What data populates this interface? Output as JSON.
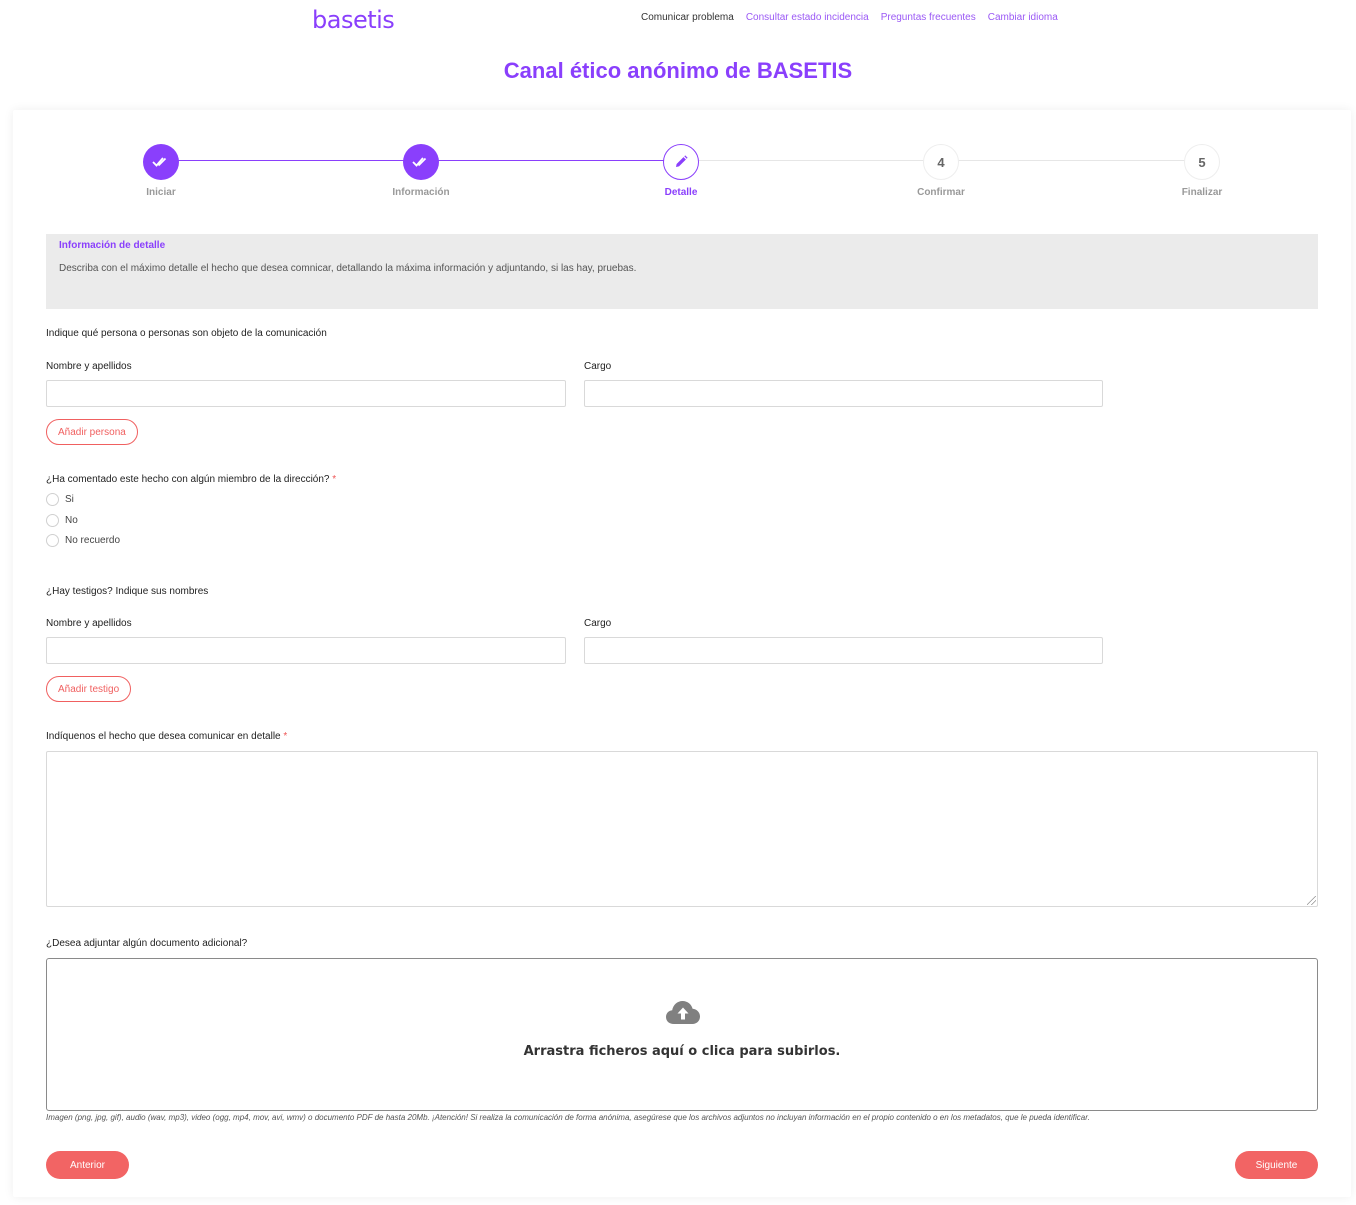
{
  "header": {
    "logo": "basetis",
    "nav": [
      "Comunicar problema",
      "Consultar estado incidencia",
      "Preguntas frecuentes",
      "Cambiar idioma"
    ]
  },
  "page_title": "Canal ético anónimo de BASETIS",
  "stepper": {
    "steps": [
      {
        "label": "Iniciar",
        "state": "done",
        "icon": "double-check-icon"
      },
      {
        "label": "Información",
        "state": "done",
        "icon": "double-check-icon"
      },
      {
        "label": "Detalle",
        "state": "active",
        "icon": "pencil-icon"
      },
      {
        "label": "Confirmar",
        "state": "todo",
        "number": "4"
      },
      {
        "label": "Finalizar",
        "state": "todo",
        "number": "5"
      }
    ]
  },
  "info": {
    "title": "Información de detalle",
    "text": "Describa con el máximo detalle el hecho que desea comnicar, detallando la máxima información y adjuntando, si las hay, pruebas."
  },
  "persons": {
    "question": "Indique qué persona o personas son objeto de la comunicación",
    "name_label": "Nombre y apellidos",
    "role_label": "Cargo",
    "add_button": "Añadir persona"
  },
  "management": {
    "question": "¿Ha comentado este hecho con algún miembro de la dirección?",
    "required_mark": "*",
    "options": [
      "Si",
      "No",
      "No recuerdo"
    ]
  },
  "witnesses": {
    "question": "¿Hay testigos? Indique sus nombres",
    "name_label": "Nombre y apellidos",
    "role_label": "Cargo",
    "add_button": "Añadir testigo"
  },
  "detail": {
    "label": "Indíquenos el hecho que desea comunicar en detalle",
    "required_mark": "*"
  },
  "attachments": {
    "label": "¿Desea adjuntar algún documento adicional?",
    "dropzone_text": "Arrastra ficheros aquí o clica para subirlos.",
    "hint": "Imagen (png, jpg, gif), audio (wav, mp3), video (ogg, mp4, mov, avi, wmv) o documento PDF de hasta 20Mb. ¡Atención! Si realiza la comunicación de forma anónima, asegúrese que los archivos adjuntos no incluyan información en el propio contenido o en los metadatos, que le pueda identificar."
  },
  "footer": {
    "prev": "Anterior",
    "next": "Siguiente"
  },
  "colors": {
    "accent": "#8a3ffc",
    "button": "#f26464"
  }
}
